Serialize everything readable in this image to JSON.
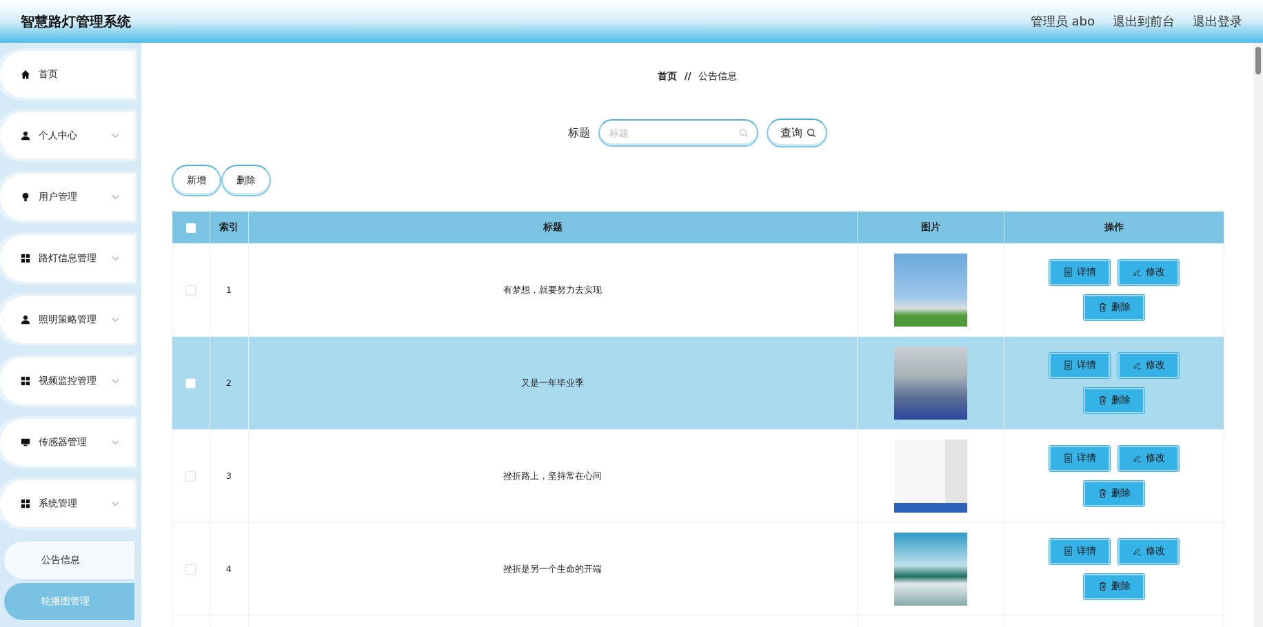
{
  "header": {
    "title": "智慧路灯管理系统",
    "user": "管理员 abo",
    "links": [
      "退出到前台",
      "退出登录"
    ]
  },
  "sidebar": {
    "items": [
      {
        "label": "首页",
        "expandable": false
      },
      {
        "label": "个人中心",
        "expandable": true
      },
      {
        "label": "用户管理",
        "expandable": true
      },
      {
        "label": "路灯信息管理",
        "expandable": true
      },
      {
        "label": "照明策略管理",
        "expandable": true
      },
      {
        "label": "视频监控管理",
        "expandable": true
      },
      {
        "label": "传感器管理",
        "expandable": true
      },
      {
        "label": "系统管理",
        "expandable": true,
        "children": [
          {
            "label": "公告信息",
            "selected": false
          },
          {
            "label": "轮播图管理",
            "selected": true
          }
        ]
      }
    ]
  },
  "breadcrumb": {
    "home": "首页",
    "separator": "//",
    "current": "公告信息"
  },
  "search": {
    "label": "标题",
    "placeholder": "标题",
    "button": "查询"
  },
  "actions": [
    "新增",
    "删除"
  ],
  "table": {
    "all_checked": false,
    "columns": [
      "索引",
      "标题",
      "图片",
      "操作"
    ],
    "rows": [
      {
        "index": "1",
        "title": "有梦想，就要努力去实现",
        "checked": false,
        "highlighted": false,
        "actions": [
          "详情",
          "修改",
          "删除"
        ]
      },
      {
        "index": "2",
        "title": "又是一年毕业季",
        "checked": false,
        "highlighted": true,
        "actions": [
          "详情",
          "修改",
          "删除"
        ]
      },
      {
        "index": "3",
        "title": "挫折路上，坚持常在心间",
        "checked": false,
        "highlighted": false,
        "actions": [
          "详情",
          "修改",
          "删除"
        ]
      },
      {
        "index": "4",
        "title": "挫折是另一个生命的开端",
        "checked": false,
        "highlighted": false,
        "actions": [
          "详情",
          "修改",
          "删除"
        ]
      }
    ]
  }
}
